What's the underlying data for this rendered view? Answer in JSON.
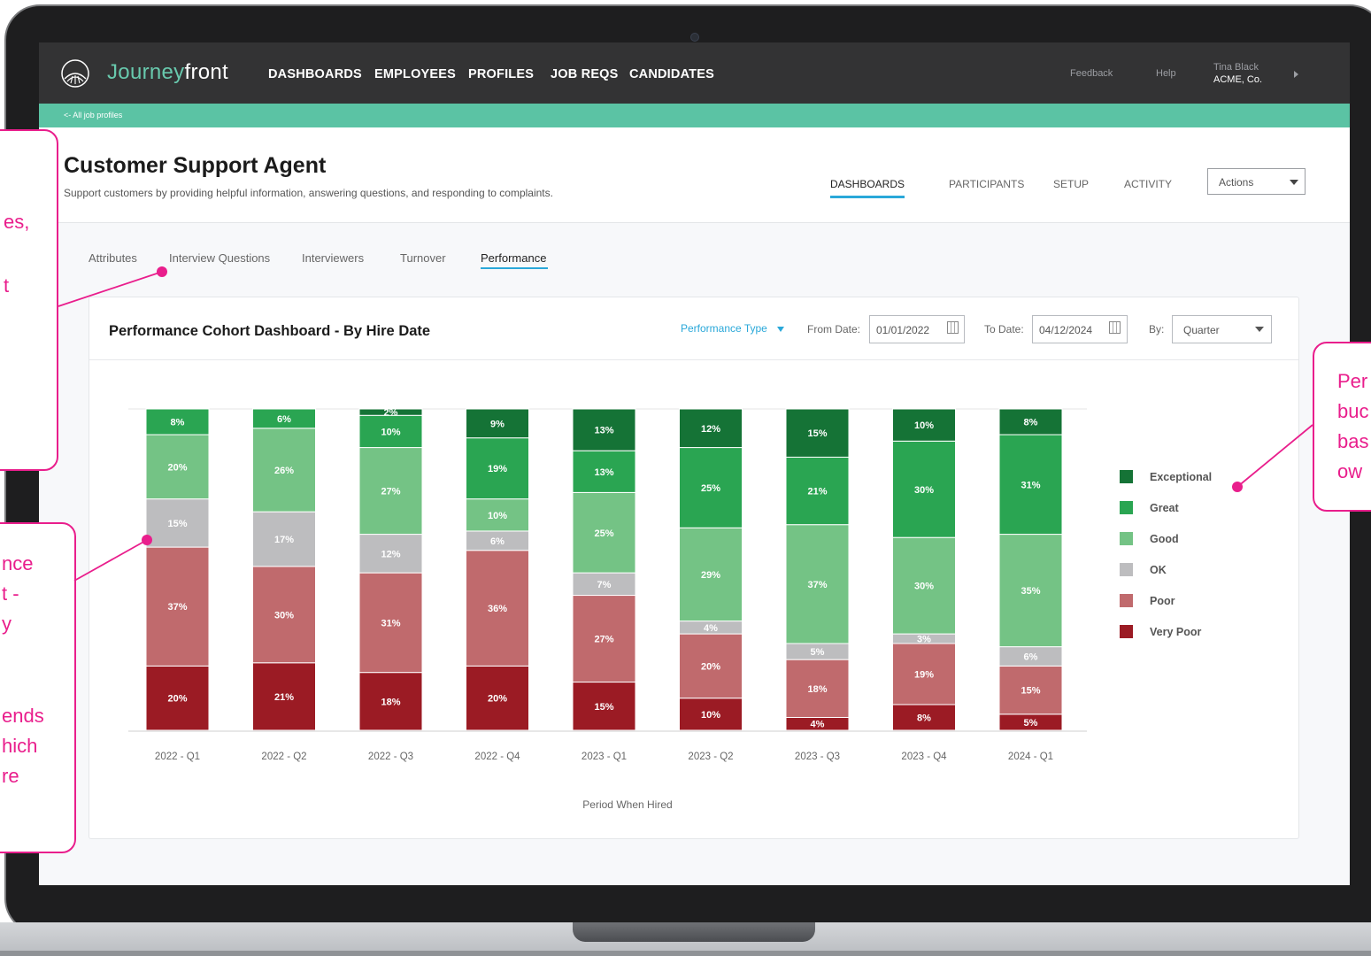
{
  "app": {
    "logo_prefix": "Journey",
    "logo_suffix": "front",
    "nav": [
      "DASHBOARDS",
      "EMPLOYEES",
      "PROFILES",
      "JOB REQS",
      "CANDIDATES"
    ],
    "feedback": "Feedback",
    "help": "Help",
    "user_name": "Tina Black",
    "user_company": "ACME, Co.",
    "back_link": "<- All job profiles"
  },
  "profile": {
    "title": "Customer Support Agent",
    "description": "Support customers by providing helpful information, answering questions, and responding to complaints.",
    "tabs": [
      "DASHBOARDS",
      "PARTICIPANTS",
      "SETUP",
      "ACTIVITY"
    ],
    "actions_label": "Actions",
    "subtabs": [
      "Attributes",
      "Interview Questions",
      "Interviewers",
      "Turnover",
      "Performance"
    ]
  },
  "dashboard": {
    "title": "Performance Cohort Dashboard - By Hire Date",
    "performance_type_label": "Performance Type",
    "from_label": "From Date:",
    "from_value": "01/01/2022",
    "to_label": "To Date:",
    "to_value": "04/12/2024",
    "by_label": "By:",
    "by_value": "Quarter"
  },
  "chart_data": {
    "type": "bar",
    "stacked": true,
    "xlabel": "Period When Hired",
    "categories": [
      "2022 - Q1",
      "2022 - Q2",
      "2022 - Q3",
      "2022 - Q4",
      "2023 - Q1",
      "2023 - Q2",
      "2023 - Q3",
      "2023 - Q4",
      "2024 - Q1"
    ],
    "series": [
      {
        "name": "Very Poor",
        "color": "#9b1b24",
        "values": [
          20,
          21,
          18,
          20,
          15,
          10,
          4,
          8,
          5
        ]
      },
      {
        "name": "Poor",
        "color": "#c06a6d",
        "values": [
          37,
          30,
          31,
          36,
          27,
          20,
          18,
          19,
          15
        ]
      },
      {
        "name": "OK",
        "color": "#bdbdbf",
        "values": [
          15,
          17,
          12,
          6,
          7,
          4,
          5,
          3,
          6
        ]
      },
      {
        "name": "Good",
        "color": "#74c385",
        "values": [
          20,
          26,
          27,
          10,
          25,
          29,
          37,
          30,
          35
        ]
      },
      {
        "name": "Great",
        "color": "#2aa552",
        "values": [
          8,
          6,
          10,
          19,
          13,
          25,
          21,
          30,
          31
        ]
      },
      {
        "name": "Exceptional",
        "color": "#157336",
        "values": [
          0,
          0,
          2,
          9,
          13,
          12,
          15,
          10,
          8
        ]
      }
    ],
    "legend_position": "right",
    "ylim": [
      0,
      100
    ]
  },
  "annotations": {
    "left_top": [
      "es,",
      "t"
    ],
    "left_bottom": [
      "nce",
      "t -",
      "y",
      "ends",
      "hich",
      "re"
    ],
    "right": [
      "Per",
      "buc",
      "bas",
      "ow"
    ]
  }
}
